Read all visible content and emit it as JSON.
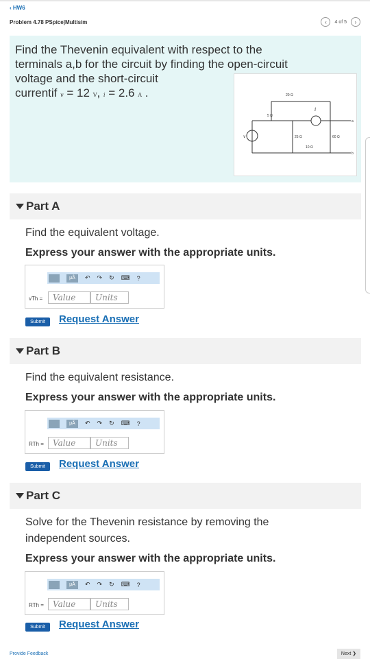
{
  "nav": {
    "back": "HW6",
    "title": "Problem 4.78 PSpice|Multisim",
    "pager": "4 of 5"
  },
  "problem": {
    "text_line1": "Find the Thevenin equivalent with respect to the",
    "text_line2": "terminals a,b for the circuit by finding the open-circuit",
    "text_line3": "voltage and the short-circuit",
    "text_line4": "currentif",
    "v_sym": "v",
    "eq1": " = 12 ",
    "v_unit": "V",
    "comma": ", ",
    "i_sym": "i",
    "eq2": " = 2.6 ",
    "i_unit": "A",
    "period": " .",
    "figure": {
      "r20": "20 Ω",
      "r5": "5 Ω",
      "r25": "25 Ω",
      "r60": "60 Ω",
      "r10": "10 Ω",
      "i_label": "i",
      "v_label": "v",
      "a_label": "a",
      "b_label": "b"
    }
  },
  "parts": [
    {
      "label": "Part A",
      "prompt": "Find the equivalent voltage.",
      "instruction": "Express your answer with the appropriate units.",
      "var_label": "vTh =",
      "value_placeholder": "Value",
      "units_placeholder": "Units",
      "submit": "Submit",
      "request": "Request Answer"
    },
    {
      "label": "Part B",
      "prompt": "Find the equivalent resistance.",
      "instruction": "Express your answer with the appropriate units.",
      "var_label": "RTh =",
      "value_placeholder": "Value",
      "units_placeholder": "Units",
      "submit": "Submit",
      "request": "Request Answer"
    },
    {
      "label": "Part C",
      "prompt_line1": "Solve for the Thevenin resistance by removing the",
      "prompt_line2": "independent sources.",
      "instruction": "Express your answer with the appropriate units.",
      "var_label": "RTh =",
      "value_placeholder": "Value",
      "units_placeholder": "Units",
      "submit": "Submit",
      "request": "Request Answer"
    }
  ],
  "toolbar": {
    "mu_label": "μÅ",
    "undo": "↶",
    "redo": "↷",
    "reset": "↻",
    "help": "?"
  },
  "footer": {
    "feedback": "Provide Feedback",
    "next": "Next ❯"
  }
}
